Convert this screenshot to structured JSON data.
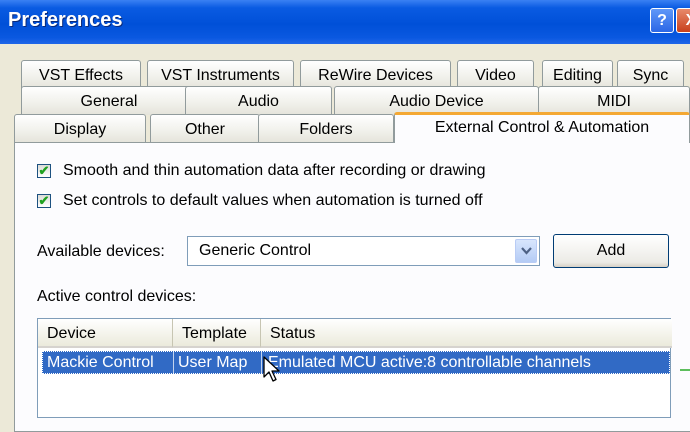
{
  "window": {
    "title": "Preferences",
    "help_label": "?",
    "close_label": "X"
  },
  "tabs": {
    "row1": [
      "VST Effects",
      "VST Instruments",
      "ReWire Devices",
      "Video",
      "Editing",
      "Sync"
    ],
    "row2": [
      "General",
      "Audio",
      "Audio Device",
      "MIDI"
    ],
    "row3": [
      "Display",
      "Other",
      "Folders",
      "External Control & Automation"
    ],
    "active": "External Control & Automation"
  },
  "options": {
    "smooth_label": "Smooth and thin automation data after recording or drawing",
    "smooth_checked": true,
    "defaults_label": "Set controls to default values when automation is turned off",
    "defaults_checked": true
  },
  "available_devices": {
    "label": "Available devices:",
    "selected": "Generic Control",
    "add_label": "Add"
  },
  "active_devices": {
    "label": "Active control devices:",
    "columns": [
      "Device",
      "Template",
      "Status"
    ],
    "rows": [
      {
        "device": "Mackie Control",
        "template": "User Map",
        "status": "Emulated MCU active:8 controllable channels",
        "selected": true
      }
    ]
  },
  "colors": {
    "titlebar": "#0050D8",
    "selection": "#316AC5",
    "active_tab_accent": "#F4A833"
  }
}
